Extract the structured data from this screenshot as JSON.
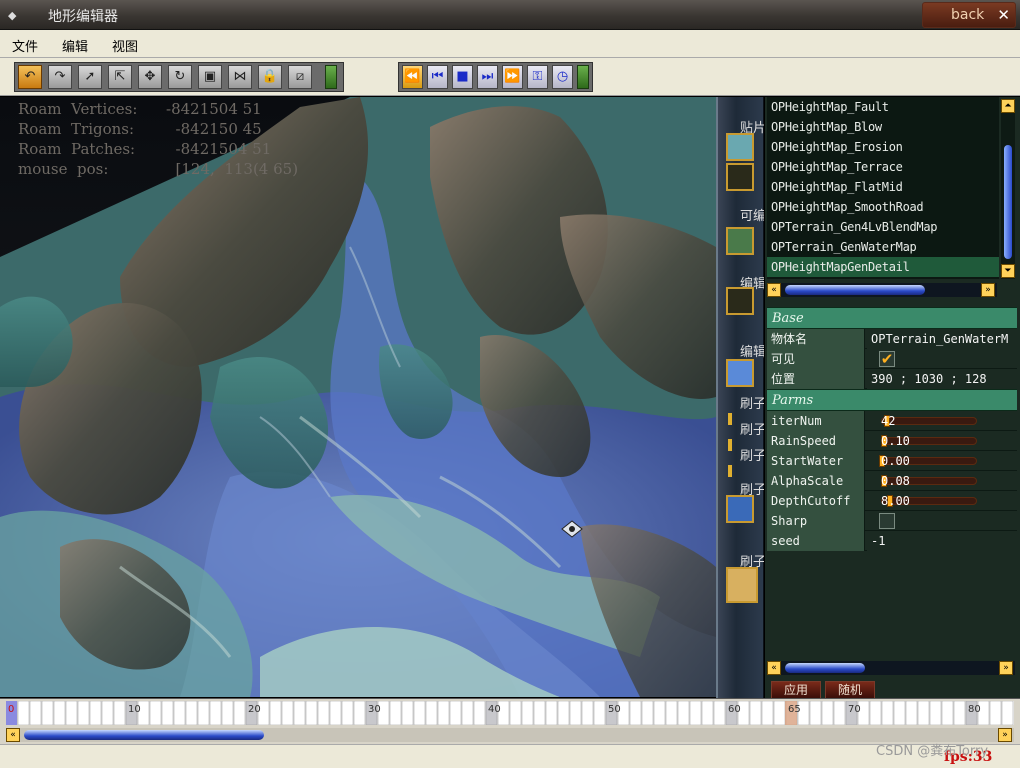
{
  "window": {
    "title": "地形编辑器",
    "back_label": "back",
    "close_glyph": "✕"
  },
  "menu": [
    "文件",
    "编辑",
    "视图"
  ],
  "toolbar": {
    "tools": [
      {
        "name": "smooth-brush-tool",
        "icon": "curve-arrow-icon",
        "glyph": "↶",
        "active": true
      },
      {
        "name": "raise-brush-tool",
        "icon": "arc-arrow-icon",
        "glyph": "↷",
        "active": false
      },
      {
        "name": "select-tool",
        "icon": "cursor-arrow-icon",
        "glyph": "➚",
        "active": false
      },
      {
        "name": "select-paint-tool",
        "icon": "cursor-grid-icon",
        "glyph": "⇱",
        "active": false
      },
      {
        "name": "move-tool",
        "icon": "move-cross-icon",
        "glyph": "✥",
        "active": false
      },
      {
        "name": "rotate-tool",
        "icon": "rotate-icon",
        "glyph": "↻",
        "active": false
      },
      {
        "name": "scale-tool",
        "icon": "square-red-icon",
        "glyph": "▣",
        "active": false
      },
      {
        "name": "split-tool",
        "icon": "split-icon",
        "glyph": "⋈",
        "active": false
      },
      {
        "name": "lock-tool",
        "icon": "lock-icon",
        "glyph": "🔒",
        "active": false
      },
      {
        "name": "wireframe-tool",
        "icon": "diagonal-grid-icon",
        "glyph": "⧄",
        "active": false
      }
    ],
    "playback": [
      {
        "name": "rewind-button",
        "icon": "rewind-icon",
        "glyph": "⏪",
        "orange": true
      },
      {
        "name": "step-back-button",
        "icon": "step-back-icon",
        "glyph": "⏮",
        "orange": false
      },
      {
        "name": "stop-button",
        "icon": "stop-icon",
        "glyph": "■",
        "orange": false
      },
      {
        "name": "step-forward-button",
        "icon": "step-forward-icon",
        "glyph": "⏭",
        "orange": false
      },
      {
        "name": "fast-forward-button",
        "icon": "fast-forward-icon",
        "glyph": "⏩",
        "orange": false
      },
      {
        "name": "key-button",
        "icon": "key-icon",
        "glyph": "⚿",
        "orange": false
      },
      {
        "name": "clock-button",
        "icon": "clock-icon",
        "glyph": "◷",
        "orange": false
      }
    ]
  },
  "viewport": {
    "stats": [
      {
        "label": "Roam  Vertices:",
        "value": "-8421504 51"
      },
      {
        "label": "Roam  Trigons:",
        "value": "  -842150 45"
      },
      {
        "label": "Roam  Patches:",
        "value": "  -8421504 51"
      },
      {
        "label": "mouse  pos:",
        "value": "  [124,  113(4 65)"
      }
    ]
  },
  "strip": {
    "labels": [
      "贴片",
      "可编",
      "编辑",
      "编辑",
      "刷子",
      "刷子",
      "刷子",
      "刷子",
      "刷子"
    ]
  },
  "operators": {
    "items": [
      "OPHeightMap_Fault",
      "OPHeightMap_Blow",
      "OPHeightMap_Erosion",
      "OPHeightMap_Terrace",
      "OPHeightMap_FlatMid",
      "OPHeightMap_SmoothRoad",
      "OPTerrain_Gen4LvBlendMap",
      "OPTerrain_GenWaterMap",
      "OPHeightMapGenDetail"
    ],
    "selected_index": 8,
    "vscroll_up": "⏶",
    "vscroll_down": "⏷",
    "hscroll_left": "«",
    "hscroll_right": "»"
  },
  "properties": {
    "base_header": "Base",
    "base": [
      {
        "name": "物体名",
        "value": "OPTerrain_GenWaterM"
      },
      {
        "name": "可见",
        "checked": true
      },
      {
        "name": "位置",
        "value": "390 ; 1030 ; 128"
      }
    ],
    "parms_header": "Parms",
    "parms": [
      {
        "name": "iterNum",
        "value": "42",
        "fill": 0.05
      },
      {
        "name": "RainSpeed",
        "value": "0.10",
        "fill": 0.02
      },
      {
        "name": "StartWater",
        "value": "0.00",
        "fill": 0.0
      },
      {
        "name": "AlphaScale",
        "value": "0.08",
        "fill": 0.02
      },
      {
        "name": "DepthCutoff",
        "value": "8.00",
        "fill": 0.08
      }
    ],
    "extra": [
      {
        "name": "Sharp",
        "checked": false
      },
      {
        "name": "seed",
        "value": "-1"
      }
    ]
  },
  "actions": {
    "apply": "应用",
    "random": "随机"
  },
  "timeline": {
    "markers": [
      "0",
      "10",
      "20",
      "30",
      "40",
      "50",
      "60",
      "65",
      "70",
      "80"
    ],
    "current_frame": "65",
    "current_fraction": 0.65,
    "scroll_left": "«",
    "scroll_right": "»"
  },
  "status": {
    "fps": "fps:33"
  },
  "watermark": "CSDN @粪布Torry"
}
